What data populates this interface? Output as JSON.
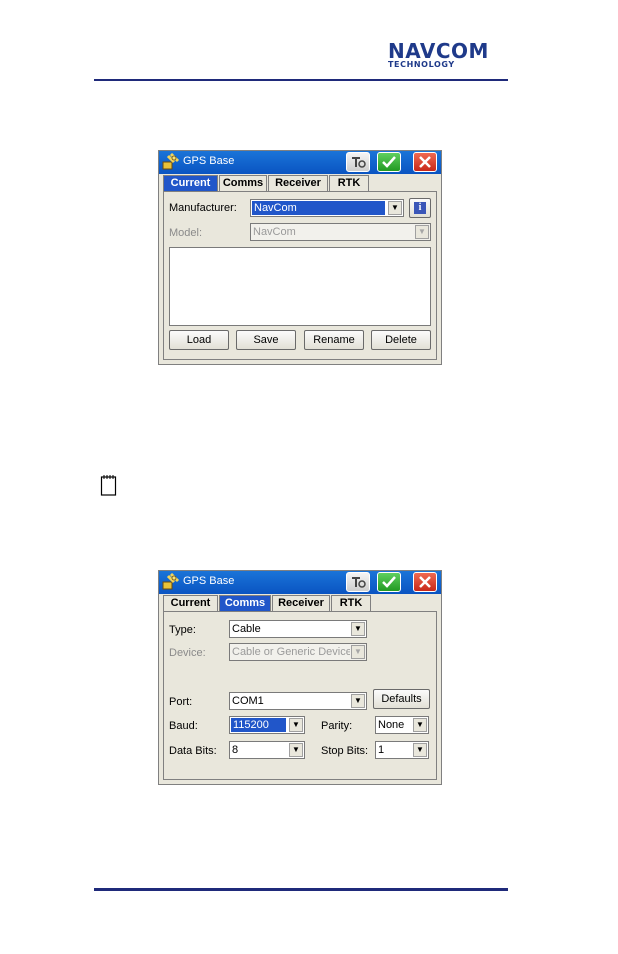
{
  "logo": {
    "line1": "NAVCOM",
    "line2": "TECHNOLOGY"
  },
  "window1": {
    "title": "GPS Base",
    "tabs": [
      {
        "label": "Current",
        "active": true
      },
      {
        "label": "Comms",
        "active": false
      },
      {
        "label": "Receiver",
        "active": false
      },
      {
        "label": "RTK",
        "active": false
      }
    ],
    "manufacturer_label": "Manufacturer:",
    "manufacturer_value": "NavCom",
    "model_label": "Model:",
    "model_value": "NavCom",
    "buttons": {
      "load": "Load",
      "save": "Save",
      "rename": "Rename",
      "delete": "Delete"
    }
  },
  "window2": {
    "title": "GPS Base",
    "tabs": [
      {
        "label": "Current",
        "active": false
      },
      {
        "label": "Comms",
        "active": true
      },
      {
        "label": "Receiver",
        "active": false
      },
      {
        "label": "RTK",
        "active": false
      }
    ],
    "type_label": "Type:",
    "type_value": "Cable",
    "device_label": "Device:",
    "device_value": "Cable or Generic Device",
    "port_label": "Port:",
    "port_value": "COM1",
    "defaults_button": "Defaults",
    "baud_label": "Baud:",
    "baud_value": "115200",
    "parity_label": "Parity:",
    "parity_value": "None",
    "databits_label": "Data Bits:",
    "databits_value": "8",
    "stopbits_label": "Stop Bits:",
    "stopbits_value": "1"
  },
  "colors": {
    "brand": "#1f3a8a",
    "titlebar": "#0a54c2",
    "selection": "#2156c9"
  }
}
